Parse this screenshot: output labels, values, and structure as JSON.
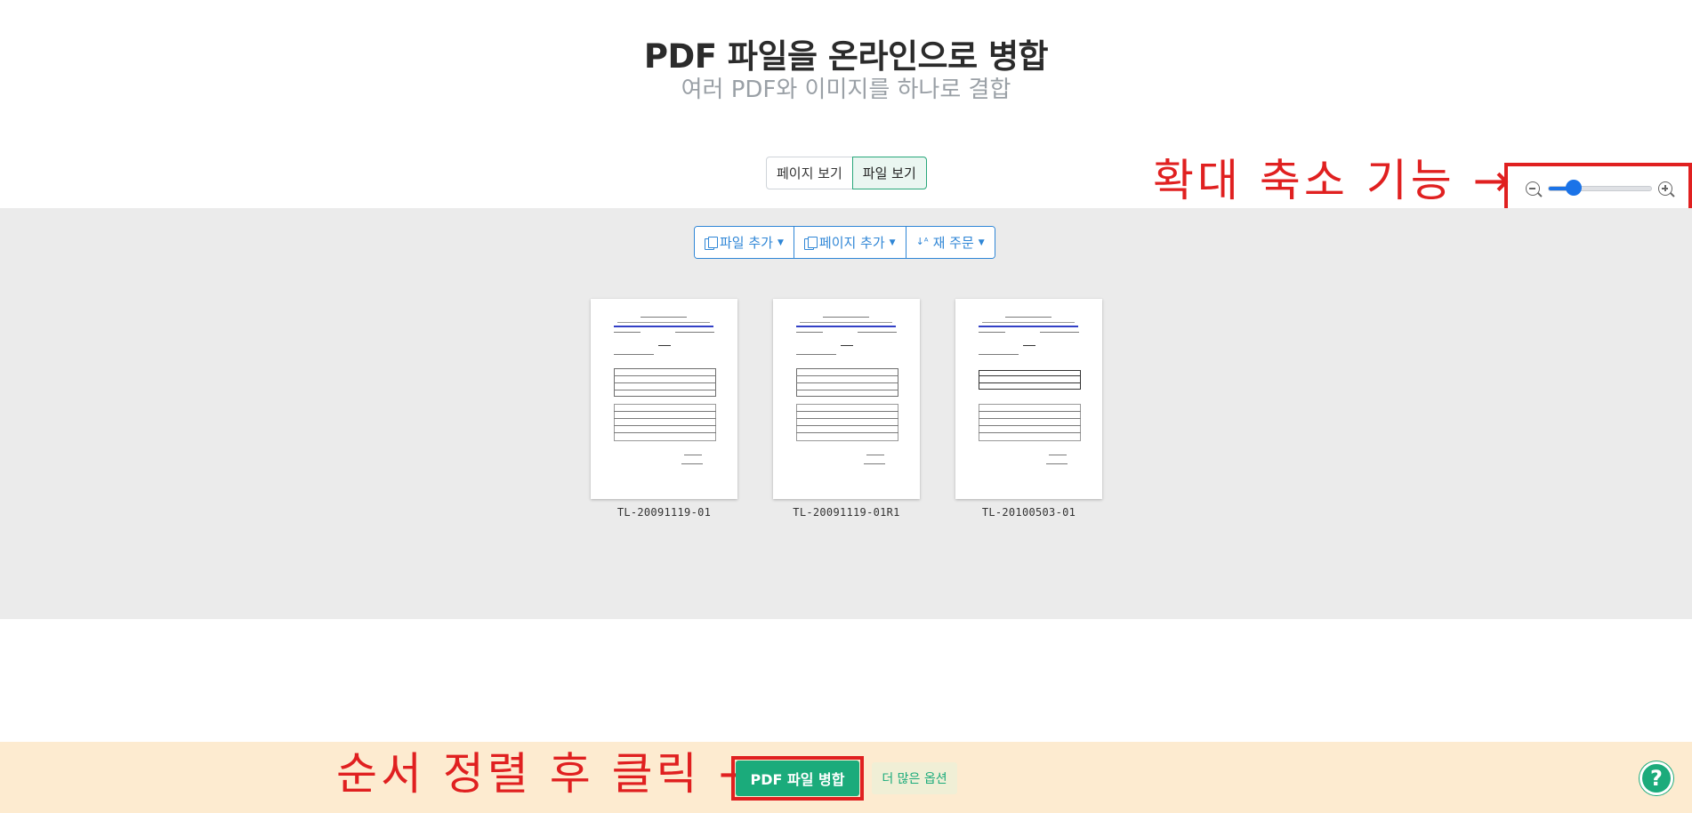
{
  "header": {
    "title": "PDF 파일을 온라인으로 병합",
    "subtitle": "여러 PDF와 이미지를 하나로 결합"
  },
  "view_toggle": {
    "page_view_label": "페이지 보기",
    "file_view_label": "파일 보기",
    "active": "file_view"
  },
  "toolbar": {
    "add_file_label": "파일 추가",
    "add_page_label": "페이지 추가",
    "reorder_label": "재 주문"
  },
  "files": [
    {
      "name": "TL-20091119-01"
    },
    {
      "name": "TL-20091119-01R1"
    },
    {
      "name": "TL-20100503-01"
    }
  ],
  "zoom": {
    "level": 0.25
  },
  "annotations": {
    "zoom_note": "확대 축소 기능 →",
    "merge_note": "순서 정렬 후 클릭 →"
  },
  "bottom_bar": {
    "merge_button_label": "PDF 파일 병합",
    "more_options_label": "더 많은 옵션",
    "help_label": "?"
  },
  "colors": {
    "accent_green": "#1bab7b",
    "toolbar_blue": "#2f86d6",
    "annotation_red": "#e02020",
    "bottom_bar_bg": "#fdebd0",
    "workspace_bg": "#ebebeb"
  }
}
